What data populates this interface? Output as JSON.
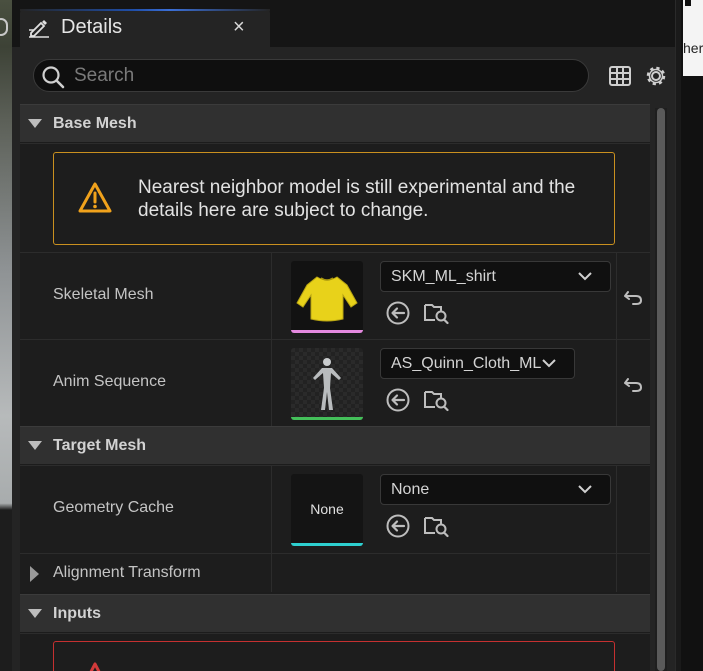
{
  "tab": {
    "title": "Details",
    "close_glyph": "×",
    "icon": "edit-pencil-icon"
  },
  "search": {
    "placeholder": "Search",
    "value": ""
  },
  "toolbar": {
    "table_icon": "table-view-icon",
    "settings_icon": "gear-icon"
  },
  "right_panel": {
    "partial_text": "her"
  },
  "categories": {
    "base_mesh": "Base Mesh",
    "target_mesh": "Target Mesh",
    "inputs": "Inputs"
  },
  "warning": {
    "icon": "warning-triangle-icon",
    "text": "Nearest neighbor model is still experimental and the details here are subject to change.",
    "color": "#f0a21c"
  },
  "properties": {
    "skeletal_mesh": {
      "label": "Skeletal Mesh",
      "value": "SKM_ML_shirt",
      "asset_color": "#e58ae0",
      "thumbnail": "yellow-shirt-thumbnail"
    },
    "anim_sequence": {
      "label": "Anim Sequence",
      "value": "AS_Quinn_Cloth_ML",
      "asset_color": "#44c05a",
      "thumbnail": "mannequin-thumbnail"
    },
    "geometry_cache": {
      "label": "Geometry Cache",
      "value": "None",
      "thumb_label": "None",
      "asset_color": "#2ed0d0"
    },
    "alignment_transform": {
      "label": "Alignment Transform"
    }
  },
  "icons": {
    "use_selected": "use-selected-arrow-icon",
    "browse": "browse-asset-icon",
    "reset": "reset-to-default-icon",
    "dropdown": "chevron-down-icon"
  }
}
